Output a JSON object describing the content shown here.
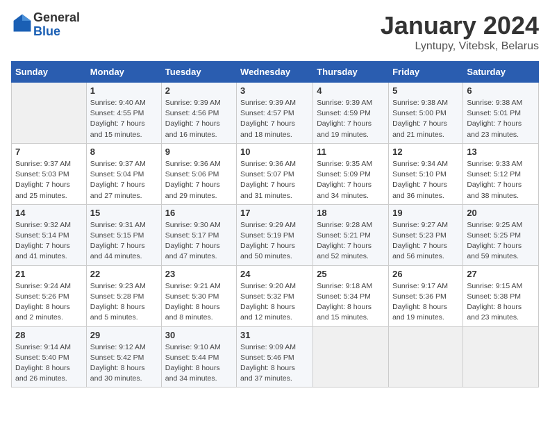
{
  "header": {
    "logo_line1": "General",
    "logo_line2": "Blue",
    "title": "January 2024",
    "subtitle": "Lyntupy, Vitebsk, Belarus"
  },
  "weekdays": [
    "Sunday",
    "Monday",
    "Tuesday",
    "Wednesday",
    "Thursday",
    "Friday",
    "Saturday"
  ],
  "weeks": [
    [
      {
        "day": "",
        "sunrise": "",
        "sunset": "",
        "daylight": ""
      },
      {
        "day": "1",
        "sunrise": "Sunrise: 9:40 AM",
        "sunset": "Sunset: 4:55 PM",
        "daylight": "Daylight: 7 hours and 15 minutes."
      },
      {
        "day": "2",
        "sunrise": "Sunrise: 9:39 AM",
        "sunset": "Sunset: 4:56 PM",
        "daylight": "Daylight: 7 hours and 16 minutes."
      },
      {
        "day": "3",
        "sunrise": "Sunrise: 9:39 AM",
        "sunset": "Sunset: 4:57 PM",
        "daylight": "Daylight: 7 hours and 18 minutes."
      },
      {
        "day": "4",
        "sunrise": "Sunrise: 9:39 AM",
        "sunset": "Sunset: 4:59 PM",
        "daylight": "Daylight: 7 hours and 19 minutes."
      },
      {
        "day": "5",
        "sunrise": "Sunrise: 9:38 AM",
        "sunset": "Sunset: 5:00 PM",
        "daylight": "Daylight: 7 hours and 21 minutes."
      },
      {
        "day": "6",
        "sunrise": "Sunrise: 9:38 AM",
        "sunset": "Sunset: 5:01 PM",
        "daylight": "Daylight: 7 hours and 23 minutes."
      }
    ],
    [
      {
        "day": "7",
        "sunrise": "Sunrise: 9:37 AM",
        "sunset": "Sunset: 5:03 PM",
        "daylight": "Daylight: 7 hours and 25 minutes."
      },
      {
        "day": "8",
        "sunrise": "Sunrise: 9:37 AM",
        "sunset": "Sunset: 5:04 PM",
        "daylight": "Daylight: 7 hours and 27 minutes."
      },
      {
        "day": "9",
        "sunrise": "Sunrise: 9:36 AM",
        "sunset": "Sunset: 5:06 PM",
        "daylight": "Daylight: 7 hours and 29 minutes."
      },
      {
        "day": "10",
        "sunrise": "Sunrise: 9:36 AM",
        "sunset": "Sunset: 5:07 PM",
        "daylight": "Daylight: 7 hours and 31 minutes."
      },
      {
        "day": "11",
        "sunrise": "Sunrise: 9:35 AM",
        "sunset": "Sunset: 5:09 PM",
        "daylight": "Daylight: 7 hours and 34 minutes."
      },
      {
        "day": "12",
        "sunrise": "Sunrise: 9:34 AM",
        "sunset": "Sunset: 5:10 PM",
        "daylight": "Daylight: 7 hours and 36 minutes."
      },
      {
        "day": "13",
        "sunrise": "Sunrise: 9:33 AM",
        "sunset": "Sunset: 5:12 PM",
        "daylight": "Daylight: 7 hours and 38 minutes."
      }
    ],
    [
      {
        "day": "14",
        "sunrise": "Sunrise: 9:32 AM",
        "sunset": "Sunset: 5:14 PM",
        "daylight": "Daylight: 7 hours and 41 minutes."
      },
      {
        "day": "15",
        "sunrise": "Sunrise: 9:31 AM",
        "sunset": "Sunset: 5:15 PM",
        "daylight": "Daylight: 7 hours and 44 minutes."
      },
      {
        "day": "16",
        "sunrise": "Sunrise: 9:30 AM",
        "sunset": "Sunset: 5:17 PM",
        "daylight": "Daylight: 7 hours and 47 minutes."
      },
      {
        "day": "17",
        "sunrise": "Sunrise: 9:29 AM",
        "sunset": "Sunset: 5:19 PM",
        "daylight": "Daylight: 7 hours and 50 minutes."
      },
      {
        "day": "18",
        "sunrise": "Sunrise: 9:28 AM",
        "sunset": "Sunset: 5:21 PM",
        "daylight": "Daylight: 7 hours and 52 minutes."
      },
      {
        "day": "19",
        "sunrise": "Sunrise: 9:27 AM",
        "sunset": "Sunset: 5:23 PM",
        "daylight": "Daylight: 7 hours and 56 minutes."
      },
      {
        "day": "20",
        "sunrise": "Sunrise: 9:25 AM",
        "sunset": "Sunset: 5:25 PM",
        "daylight": "Daylight: 7 hours and 59 minutes."
      }
    ],
    [
      {
        "day": "21",
        "sunrise": "Sunrise: 9:24 AM",
        "sunset": "Sunset: 5:26 PM",
        "daylight": "Daylight: 8 hours and 2 minutes."
      },
      {
        "day": "22",
        "sunrise": "Sunrise: 9:23 AM",
        "sunset": "Sunset: 5:28 PM",
        "daylight": "Daylight: 8 hours and 5 minutes."
      },
      {
        "day": "23",
        "sunrise": "Sunrise: 9:21 AM",
        "sunset": "Sunset: 5:30 PM",
        "daylight": "Daylight: 8 hours and 8 minutes."
      },
      {
        "day": "24",
        "sunrise": "Sunrise: 9:20 AM",
        "sunset": "Sunset: 5:32 PM",
        "daylight": "Daylight: 8 hours and 12 minutes."
      },
      {
        "day": "25",
        "sunrise": "Sunrise: 9:18 AM",
        "sunset": "Sunset: 5:34 PM",
        "daylight": "Daylight: 8 hours and 15 minutes."
      },
      {
        "day": "26",
        "sunrise": "Sunrise: 9:17 AM",
        "sunset": "Sunset: 5:36 PM",
        "daylight": "Daylight: 8 hours and 19 minutes."
      },
      {
        "day": "27",
        "sunrise": "Sunrise: 9:15 AM",
        "sunset": "Sunset: 5:38 PM",
        "daylight": "Daylight: 8 hours and 23 minutes."
      }
    ],
    [
      {
        "day": "28",
        "sunrise": "Sunrise: 9:14 AM",
        "sunset": "Sunset: 5:40 PM",
        "daylight": "Daylight: 8 hours and 26 minutes."
      },
      {
        "day": "29",
        "sunrise": "Sunrise: 9:12 AM",
        "sunset": "Sunset: 5:42 PM",
        "daylight": "Daylight: 8 hours and 30 minutes."
      },
      {
        "day": "30",
        "sunrise": "Sunrise: 9:10 AM",
        "sunset": "Sunset: 5:44 PM",
        "daylight": "Daylight: 8 hours and 34 minutes."
      },
      {
        "day": "31",
        "sunrise": "Sunrise: 9:09 AM",
        "sunset": "Sunset: 5:46 PM",
        "daylight": "Daylight: 8 hours and 37 minutes."
      },
      {
        "day": "",
        "sunrise": "",
        "sunset": "",
        "daylight": ""
      },
      {
        "day": "",
        "sunrise": "",
        "sunset": "",
        "daylight": ""
      },
      {
        "day": "",
        "sunrise": "",
        "sunset": "",
        "daylight": ""
      }
    ]
  ]
}
